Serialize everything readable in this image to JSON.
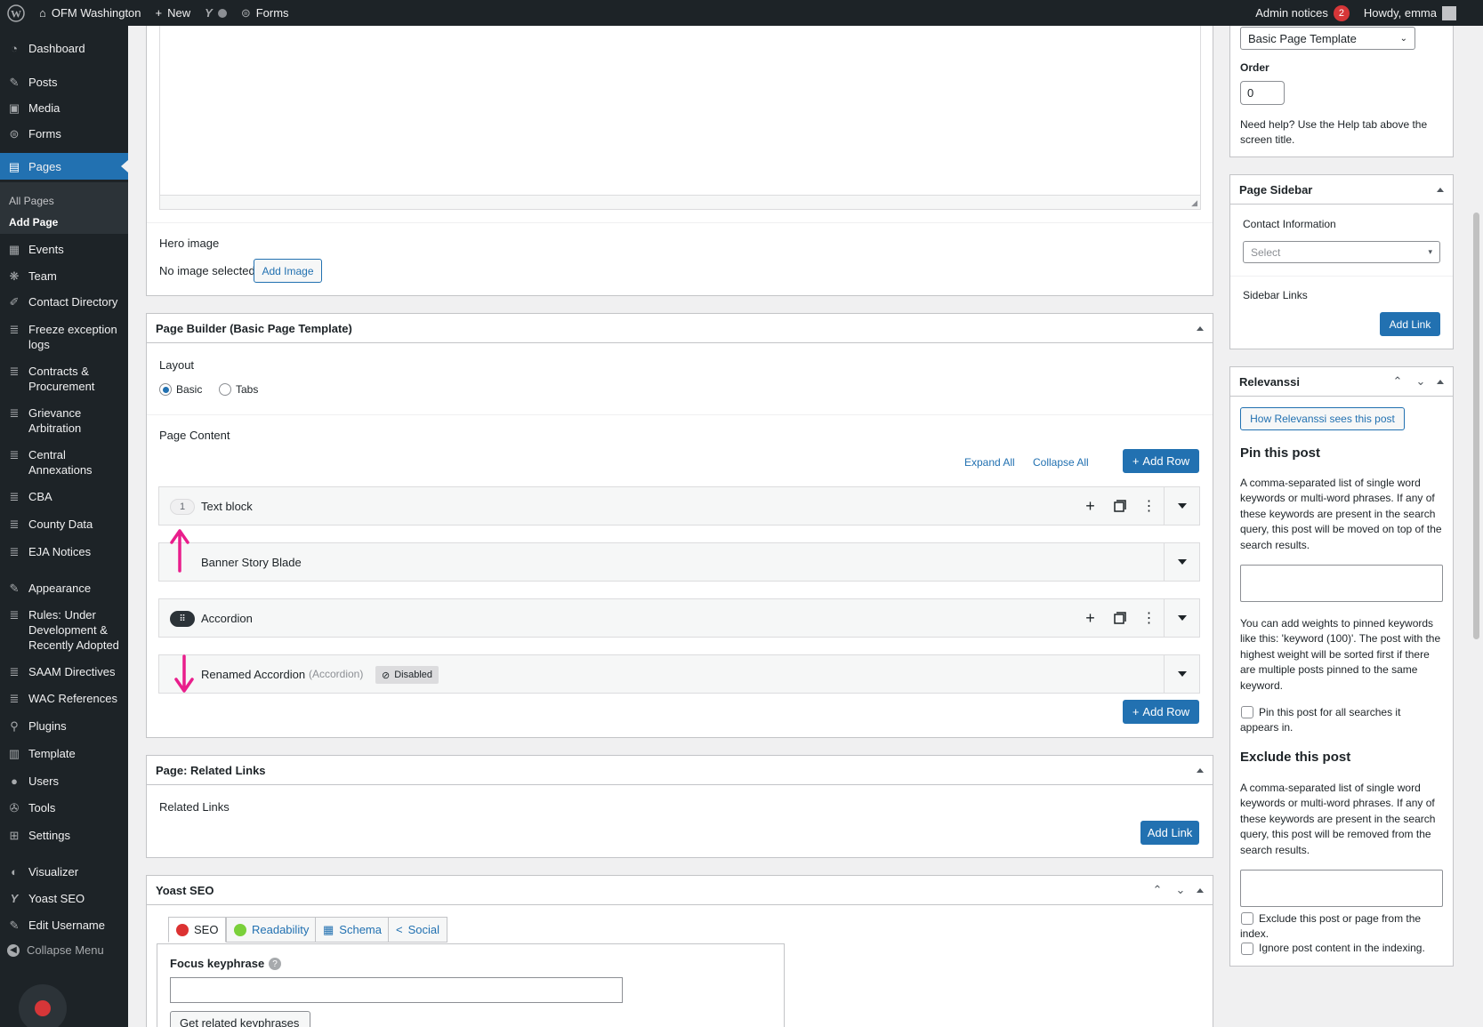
{
  "adminbar": {
    "site_name": "OFM Washington",
    "new_label": "New",
    "forms_label": "Forms",
    "admin_notices_label": "Admin notices",
    "admin_notices_count": "2",
    "howdy": "Howdy, emma"
  },
  "sidebar": {
    "items": [
      {
        "label": "Dashboard",
        "icon": "dashboard-icon"
      },
      {
        "label": "Posts",
        "icon": "pin-icon"
      },
      {
        "label": "Media",
        "icon": "media-icon"
      },
      {
        "label": "Forms",
        "icon": "forms-icon"
      },
      {
        "label": "Pages",
        "icon": "pages-icon"
      },
      {
        "label": "Events",
        "icon": "calendar-icon"
      },
      {
        "label": "Team",
        "icon": "team-icon"
      },
      {
        "label": "Contact Directory",
        "icon": "brush-icon"
      },
      {
        "label": "Freeze exception logs",
        "icon": "database-icon"
      },
      {
        "label": "Contracts & Procurement",
        "icon": "database-icon"
      },
      {
        "label": "Grievance Arbitration",
        "icon": "database-icon"
      },
      {
        "label": "Central Annexations",
        "icon": "database-icon"
      },
      {
        "label": "CBA",
        "icon": "database-icon"
      },
      {
        "label": "County Data",
        "icon": "database-icon"
      },
      {
        "label": "EJA Notices",
        "icon": "database-icon"
      },
      {
        "label": "Appearance",
        "icon": "appearance-icon"
      },
      {
        "label": "Rules: Under Development & Recently Adopted",
        "icon": "database-icon"
      },
      {
        "label": "SAAM Directives",
        "icon": "database-icon"
      },
      {
        "label": "WAC References",
        "icon": "database-icon"
      },
      {
        "label": "Plugins",
        "icon": "plugins-icon"
      },
      {
        "label": "Template",
        "icon": "template-icon"
      },
      {
        "label": "Users",
        "icon": "users-icon"
      },
      {
        "label": "Tools",
        "icon": "tools-icon"
      },
      {
        "label": "Settings",
        "icon": "settings-icon"
      },
      {
        "label": "Visualizer",
        "icon": "visualizer-icon"
      },
      {
        "label": "Yoast SEO",
        "icon": "yoast-icon"
      },
      {
        "label": "Edit Username",
        "icon": "edit-icon"
      }
    ],
    "submenu": [
      "All Pages",
      "Add Page"
    ],
    "collapse_label": "Collapse Menu"
  },
  "editor": {
    "hero_label": "Hero image",
    "no_image": "No image selected",
    "add_image": "Add Image"
  },
  "page_builder": {
    "title": "Page Builder (Basic Page Template)",
    "layout_label": "Layout",
    "layout_options": [
      "Basic",
      "Tabs"
    ],
    "layout_selected": "Basic",
    "page_content_label": "Page Content",
    "expand_all": "Expand All",
    "collapse_all": "Collapse All",
    "add_row": "Add Row",
    "rows": [
      {
        "index": "1",
        "title": "Text block"
      },
      {
        "index": "",
        "title": "Banner Story Blade"
      },
      {
        "index": "",
        "title": "Accordion"
      },
      {
        "index": "",
        "title": "Renamed Accordion",
        "subtitle": "(Accordion)",
        "badge": "Disabled"
      }
    ]
  },
  "related_links": {
    "title": "Page: Related Links",
    "label": "Related Links",
    "add_link": "Add Link"
  },
  "yoast": {
    "title": "Yoast SEO",
    "tabs": [
      "SEO",
      "Readability",
      "Schema",
      "Social"
    ],
    "focus_label": "Focus keyphrase",
    "related_button": "Get related keyphrases"
  },
  "right": {
    "template_value": "Basic Page Template",
    "order_label": "Order",
    "order_value": "0",
    "help_text": "Need help? Use the Help tab above the screen title.",
    "sidebar_title": "Page Sidebar",
    "contact_label": "Contact Information",
    "contact_placeholder": "Select",
    "sidebar_links_label": "Sidebar Links",
    "add_link": "Add Link",
    "relevanssi_title": "Relevanssi",
    "relevanssi_button": "How Relevanssi sees this post",
    "pin_title": "Pin this post",
    "pin_text": "A comma-separated list of single word keywords or multi-word phrases. If any of these keywords are present in the search query, this post will be moved on top of the search results.",
    "weights_text": "You can add weights to pinned keywords like this: 'keyword (100)'. The post with the highest weight will be sorted first if there are multiple posts pinned to the same keyword.",
    "pin_all_label": "Pin this post for all searches it appears in.",
    "exclude_title": "Exclude this post",
    "exclude_text": "A comma-separated list of single word keywords or multi-word phrases. If any of these keywords are present in the search query, this post will be removed from the search results.",
    "exclude_index_label": "Exclude this post or page from the index.",
    "ignore_content_label": "Ignore post content in the indexing."
  },
  "colors": {
    "accent": "#2271b1",
    "admin_bg": "#1d2327",
    "annotation": "#e91e8c",
    "notice": "#d63638"
  }
}
